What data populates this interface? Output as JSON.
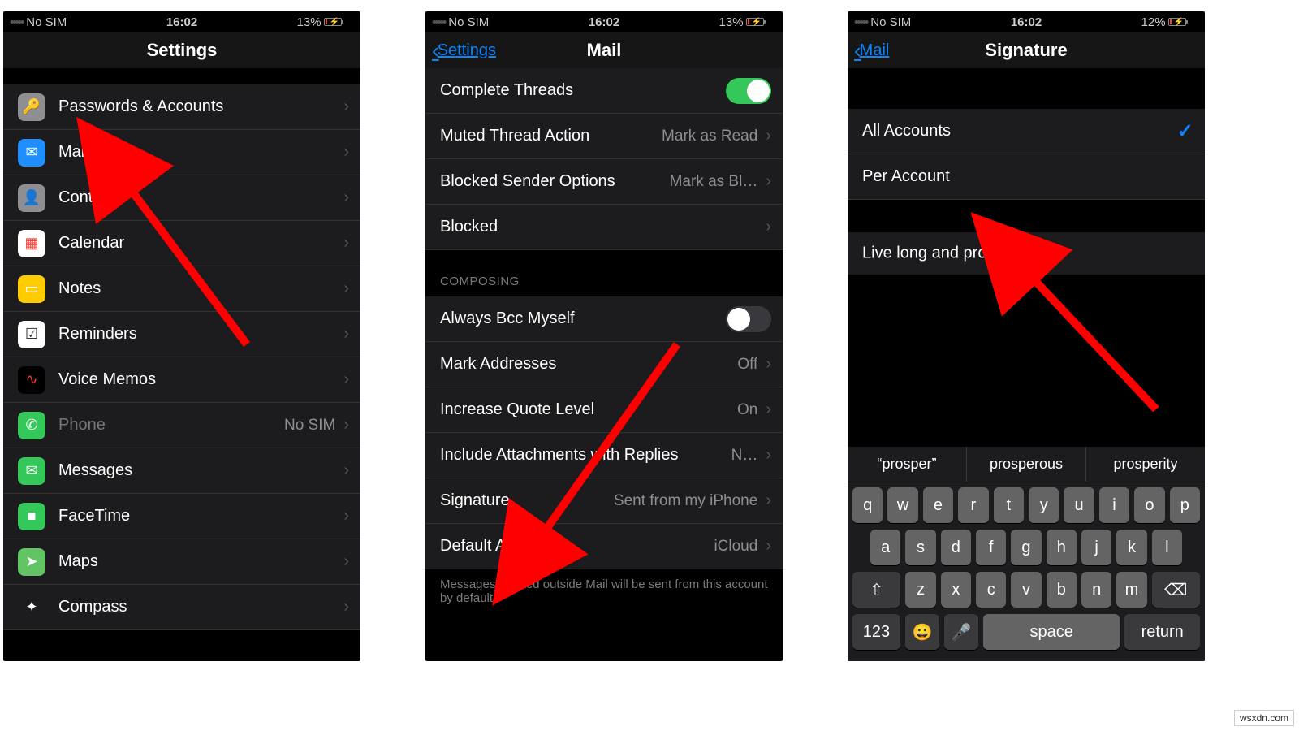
{
  "status": {
    "carrier": "No SIM",
    "time": "16:02",
    "battery12": "12%",
    "battery13": "13%"
  },
  "watermark": "wsxdn.com",
  "screen1": {
    "title": "Settings",
    "items": [
      {
        "name": "passwords",
        "icon": "🔑",
        "bg": "#8e8e93",
        "label": "Passwords & Accounts"
      },
      {
        "name": "mail",
        "icon": "✉︎",
        "bg": "#1f8fff",
        "label": "Mail"
      },
      {
        "name": "contacts",
        "icon": "👤",
        "bg": "#8e8e93",
        "label": "Contacts"
      },
      {
        "name": "calendar",
        "icon": "▦",
        "bg": "#ffffff",
        "fg": "#ff3b30",
        "label": "Calendar"
      },
      {
        "name": "notes",
        "icon": "▭",
        "bg": "#ffcc00",
        "label": "Notes"
      },
      {
        "name": "reminders",
        "icon": "☑",
        "bg": "#ffffff",
        "fg": "#333",
        "label": "Reminders"
      },
      {
        "name": "voice-memos",
        "icon": "∿",
        "bg": "#000",
        "fg": "#ff3b30",
        "label": "Voice Memos"
      },
      {
        "name": "phone",
        "icon": "✆",
        "bg": "#34c759",
        "label": "Phone",
        "value": "No SIM",
        "dim": true
      },
      {
        "name": "messages",
        "icon": "✉",
        "bg": "#34c759",
        "label": "Messages"
      },
      {
        "name": "facetime",
        "icon": "■",
        "bg": "#34c759",
        "label": "FaceTime"
      },
      {
        "name": "maps",
        "icon": "➤",
        "bg": "#63c466",
        "label": "Maps"
      },
      {
        "name": "compass",
        "icon": "✦",
        "bg": "#1c1c1e",
        "label": "Compass"
      }
    ]
  },
  "screen2": {
    "back": "Settings",
    "title": "Mail",
    "threads": [
      {
        "label": "Complete Threads",
        "toggle": "on"
      },
      {
        "label": "Muted Thread Action",
        "value": "Mark as Read"
      },
      {
        "label": "Blocked Sender Options",
        "value": "Mark as Bl…"
      },
      {
        "label": "Blocked"
      }
    ],
    "composing_header": "COMPOSING",
    "composing": [
      {
        "label": "Always Bcc Myself",
        "toggle": "off"
      },
      {
        "label": "Mark Addresses",
        "value": "Off"
      },
      {
        "label": "Increase Quote Level",
        "value": "On"
      },
      {
        "label": "Include Attachments with Replies",
        "value": "N…"
      },
      {
        "label": "Signature",
        "value": "Sent from my iPhone"
      },
      {
        "label": "Default Account",
        "value": "iCloud"
      }
    ],
    "footer": "Messages created outside Mail will be sent from this account by default."
  },
  "screen3": {
    "back": "Mail",
    "title": "Signature",
    "scope": [
      {
        "label": "All Accounts",
        "checked": true
      },
      {
        "label": "Per Account"
      }
    ],
    "signature_text": "Live long and prosper",
    "suggestions": [
      "“prosper”",
      "prosperous",
      "prosperity"
    ],
    "keyboard": {
      "r1": [
        "q",
        "w",
        "e",
        "r",
        "t",
        "y",
        "u",
        "i",
        "o",
        "p"
      ],
      "r2": [
        "a",
        "s",
        "d",
        "f",
        "g",
        "h",
        "j",
        "k",
        "l"
      ],
      "r3": [
        "z",
        "x",
        "c",
        "v",
        "b",
        "n",
        "m"
      ],
      "labels": {
        "shift": "⇧",
        "del": "⌫",
        "num": "123",
        "emoji": "😀",
        "mic": "🎤",
        "space": "space",
        "return": "return"
      }
    }
  }
}
